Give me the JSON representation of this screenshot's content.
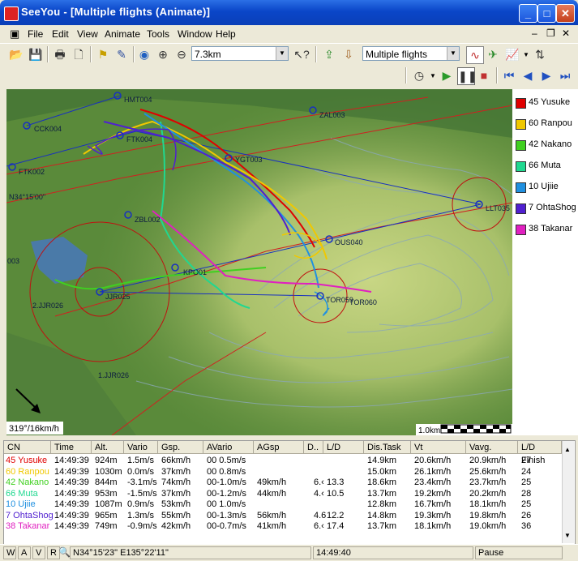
{
  "window": {
    "title": "SeeYou - [Multiple flights (Animate)]"
  },
  "menu": [
    "File",
    "Edit",
    "View",
    "Animate",
    "Tools",
    "Window",
    "Help"
  ],
  "toolbar": {
    "zoom_value": "7.3km",
    "view_mode": "Multiple flights"
  },
  "map": {
    "turnpoints": [
      "HMT004",
      "ZAL003",
      "CCK004",
      "FTK004",
      "FTK002",
      "YGT003",
      "ZBL002",
      "OUS040",
      "KPO01",
      "JJR025",
      "TOR059",
      "TOR060",
      "LLT035",
      "2.JJR026",
      "1.JJR026",
      "003"
    ],
    "coord_label": "N34°15'00\"",
    "wind_label": "319°/16km/h",
    "scale_label": "1.0km"
  },
  "legend": [
    {
      "label": "45 Yusuke",
      "color": "#e00000"
    },
    {
      "label": "60 Ranpou",
      "color": "#f0c800"
    },
    {
      "label": "42 Nakano",
      "color": "#40d020"
    },
    {
      "label": "66 Muta",
      "color": "#20d890"
    },
    {
      "label": "10 Ujiie",
      "color": "#2090e0"
    },
    {
      "label": "7 OhtaShog",
      "color": "#5020d0"
    },
    {
      "label": "38 Takanar",
      "color": "#e020c0"
    }
  ],
  "table": {
    "headers": [
      "CN",
      "Time",
      "Alt.",
      "Vario",
      "Gsp.",
      "AVario",
      "AGsp",
      "D..",
      "L/D",
      "Dis.Task",
      "Vt",
      "Vavg.",
      "L/D Finish"
    ],
    "rows": [
      {
        "cn": "45 Yusuke",
        "time": "14:49:39",
        "alt": "924m",
        "vario": "1.5m/s",
        "gsp": "66km/h",
        "avario": "00 0.5m/s",
        "agsp": "",
        "d": "",
        "ld": "",
        "dis": "14.9km",
        "vt": "20.6km/h",
        "vavg": "20.9km/h",
        "ldf": "27",
        "color": "#e00000"
      },
      {
        "cn": "60 Ranpou",
        "time": "14:49:39",
        "alt": "1030m",
        "vario": "0.0m/s",
        "gsp": "37km/h",
        "avario": "00 0.8m/s",
        "agsp": "",
        "d": "",
        "ld": "",
        "dis": "15.0km",
        "vt": "26.1km/h",
        "vavg": "25.6km/h",
        "ldf": "24",
        "color": "#f0c800"
      },
      {
        "cn": "42 Nakano",
        "time": "14:49:39",
        "alt": "844m",
        "vario": "-3.1m/s",
        "gsp": "74km/h",
        "avario": "00-1.0m/s",
        "agsp": "49km/h",
        "d": "6.‹",
        "ld": "13.3",
        "dis": "18.6km",
        "vt": "23.4km/h",
        "vavg": "23.7km/h",
        "ldf": "25",
        "color": "#40d020"
      },
      {
        "cn": "66 Muta",
        "time": "14:49:39",
        "alt": "953m",
        "vario": "-1.5m/s",
        "gsp": "37km/h",
        "avario": "00-1.2m/s",
        "agsp": "44km/h",
        "d": "4.‹",
        "ld": "10.5",
        "dis": "13.7km",
        "vt": "19.2km/h",
        "vavg": "20.2km/h",
        "ldf": "28",
        "color": "#20d890"
      },
      {
        "cn": "10 Ujiie",
        "time": "14:49:39",
        "alt": "1087m",
        "vario": "0.9m/s",
        "gsp": "53km/h",
        "avario": "00 1.0m/s",
        "agsp": "",
        "d": "",
        "ld": "",
        "dis": "12.8km",
        "vt": "16.7km/h",
        "vavg": "18.1km/h",
        "ldf": "25",
        "color": "#2090e0"
      },
      {
        "cn": "7 OhtaShog",
        "time": "14:49:39",
        "alt": "965m",
        "vario": "1.3m/s",
        "gsp": "55km/h",
        "avario": "00-1.3m/s",
        "agsp": "56km/h",
        "d": "4.6",
        "ld": "12.2",
        "dis": "14.8km",
        "vt": "19.3km/h",
        "vavg": "19.8km/h",
        "ldf": "26",
        "color": "#5020d0"
      },
      {
        "cn": "38 Takanar",
        "time": "14:49:39",
        "alt": "749m",
        "vario": "-0.9m/s",
        "gsp": "42km/h",
        "avario": "00-0.7m/s",
        "agsp": "41km/h",
        "d": "6.‹",
        "ld": "17.4",
        "dis": "13.7km",
        "vt": "18.1km/h",
        "vavg": "19.0km/h",
        "ldf": "36",
        "color": "#e020c0"
      }
    ]
  },
  "status": {
    "tabs": [
      "W",
      "A",
      "V",
      "R"
    ],
    "coords": "N34°15'23\"  E135°22'11\"",
    "time": "14:49:40",
    "state": "Pause"
  }
}
